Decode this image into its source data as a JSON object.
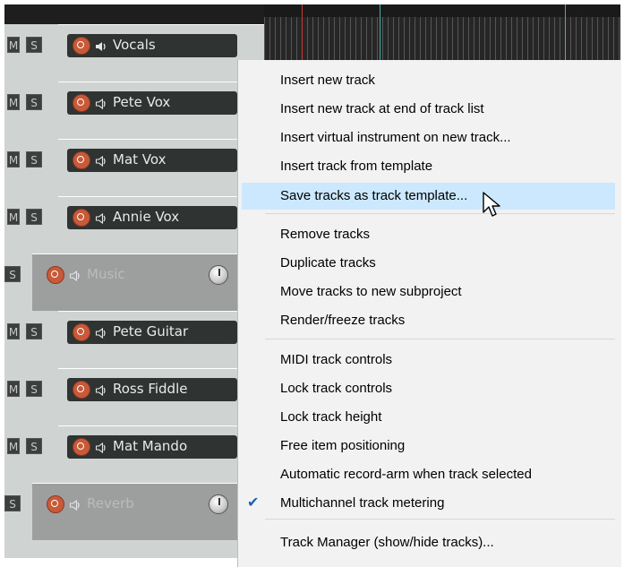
{
  "tracks": [
    {
      "name": "Vocals",
      "mute": "M",
      "solo": "S",
      "speaker": "speaker-filled-icon"
    },
    {
      "name": "Pete Vox",
      "mute": "M",
      "solo": "S",
      "speaker": "speaker-outline-icon"
    },
    {
      "name": "Mat Vox",
      "mute": "M",
      "solo": "S",
      "speaker": "speaker-outline-icon"
    },
    {
      "name": "Annie Vox",
      "mute": "M",
      "solo": "S",
      "speaker": "speaker-outline-icon"
    },
    {
      "name": "Music",
      "mute": "",
      "solo": "S",
      "speaker": "speaker-outline-icon",
      "folder": true
    },
    {
      "name": "Pete Guitar",
      "mute": "M",
      "solo": "S",
      "speaker": "speaker-outline-icon"
    },
    {
      "name": "Ross Fiddle",
      "mute": "M",
      "solo": "S",
      "speaker": "speaker-outline-icon"
    },
    {
      "name": "Mat Mando",
      "mute": "M",
      "solo": "S",
      "speaker": "speaker-outline-icon"
    },
    {
      "name": "Reverb",
      "mute": "",
      "solo": "S",
      "speaker": "speaker-outline-icon",
      "folder": true
    }
  ],
  "menu": {
    "items": [
      "Insert new track",
      "Insert new track at end of track list",
      "Insert virtual instrument on new track...",
      "Insert track from template",
      "Save tracks as track template...",
      "Remove tracks",
      "Duplicate tracks",
      "Move tracks to new subproject",
      "Render/freeze tracks",
      "MIDI track controls",
      "Lock track controls",
      "Lock track height",
      "Free item positioning",
      "Automatic record-arm when track selected",
      "Multichannel track metering",
      "Track Manager (show/hide tracks)..."
    ],
    "highlighted_index": 4,
    "checked_index": 14,
    "check_glyph": "✔"
  },
  "colors": {
    "highlight": "#cce8ff",
    "rec_arm": "#c85a3a",
    "playcursor": "#c83a3a",
    "loop_marker": "#3fb3b0"
  }
}
